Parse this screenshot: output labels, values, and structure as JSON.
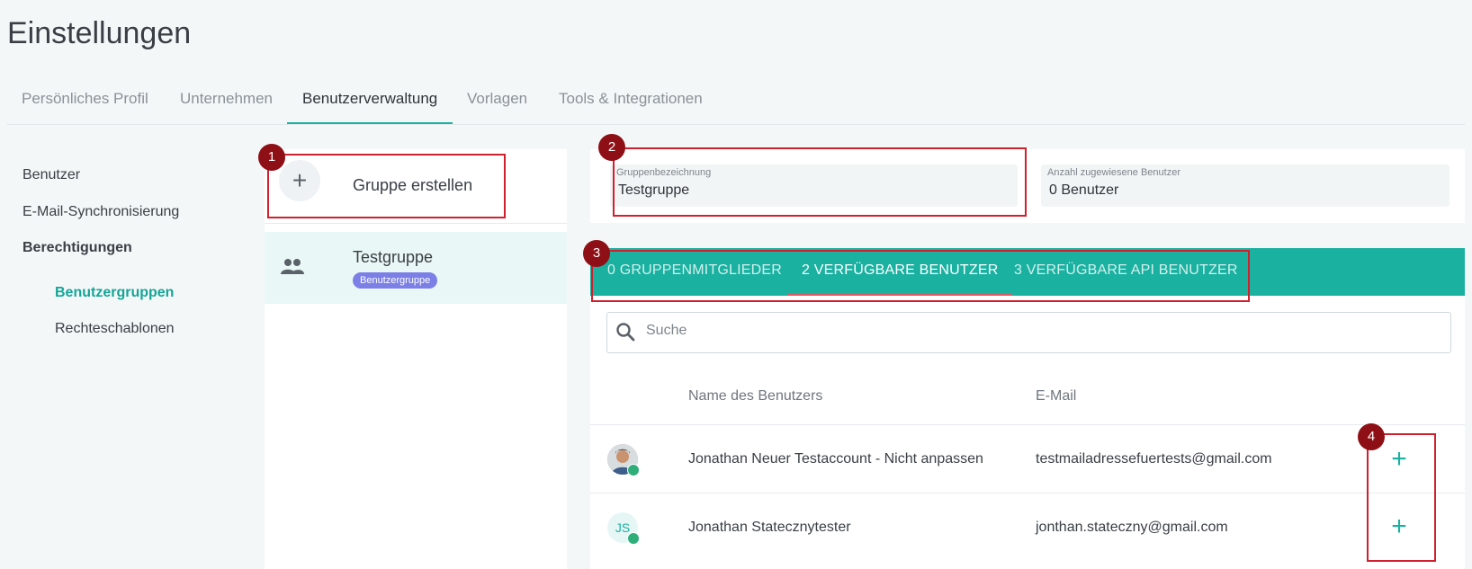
{
  "page_title": "Einstellungen",
  "top_tabs": [
    {
      "label": "Persönliches Profil",
      "active": false
    },
    {
      "label": "Unternehmen",
      "active": false
    },
    {
      "label": "Benutzerverwaltung",
      "active": true
    },
    {
      "label": "Vorlagen",
      "active": false
    },
    {
      "label": "Tools & Integrationen",
      "active": false
    }
  ],
  "sidebar": {
    "items": [
      {
        "label": "Benutzer"
      },
      {
        "label": "E-Mail-Synchronisierung"
      },
      {
        "label": "Berechtigungen"
      },
      {
        "label": "Benutzergruppen",
        "selected": true
      },
      {
        "label": "Rechteschablonen"
      }
    ]
  },
  "groups": {
    "create_label": "Gruppe erstellen",
    "create_icon": "plus-icon",
    "items": [
      {
        "name": "Testgruppe",
        "badge": "Benutzergruppe",
        "icon": "people-icon"
      }
    ]
  },
  "form": {
    "group_name_label": "Gruppenbezeichnung",
    "group_name_value": "Testgruppe",
    "user_count_label": "Anzahl zugewiesene Benutzer",
    "user_count_value": "0 Benutzer"
  },
  "subtabs": [
    {
      "label": "0 GRUPPENMITGLIEDER",
      "active": false
    },
    {
      "label": "2 VERFÜGBARE BENUTZER",
      "active": true
    },
    {
      "label": "3 VERFÜGBARE API BENUTZER",
      "active": false
    }
  ],
  "search": {
    "placeholder": "Suche",
    "icon": "search-icon"
  },
  "table": {
    "columns": [
      "Name des Benutzers",
      "E-Mail"
    ],
    "rows": [
      {
        "avatar": "photo",
        "initials": "",
        "name": "Jonathan Neuer Testaccount - Nicht anpassen",
        "email": "testmailadressefuertests@gmail.com",
        "action": "+"
      },
      {
        "avatar": "initials",
        "initials": "JS",
        "name": "Jonathan Statecznytester",
        "email": "jonthan.stateczny@gmail.com",
        "action": "+"
      }
    ]
  },
  "annotations": [
    "1",
    "2",
    "3",
    "4"
  ],
  "colors": {
    "accent": "#1ab1a1",
    "annotation": "#d0202e",
    "badge": "#7b7fe6"
  }
}
